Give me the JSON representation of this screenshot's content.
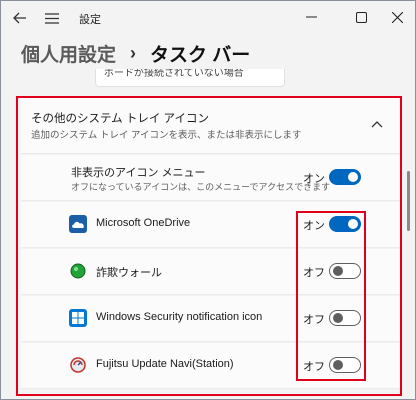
{
  "titlebar": {
    "app_title": "設定",
    "back_icon": "back-arrow-icon",
    "menu_icon": "hamburger-menu-icon"
  },
  "heading": {
    "parent": "個人用設定",
    "separator": "›",
    "current": "タスク バー"
  },
  "partial_dropdown": {
    "text": "ボードが接続されていない場合"
  },
  "section": {
    "title": "その他のシステム トレイ アイコン",
    "description": "追加のシステム トレイ アイコンを表示、または非表示にします",
    "expanded": true
  },
  "hidden_icon_menu": {
    "title": "非表示のアイコン メニュー",
    "subtitle": "オフになっているアイコンは、このメニューでアクセスできます",
    "state": "オン",
    "on": true
  },
  "tray_items": [
    {
      "label": "Microsoft OneDrive",
      "state": "オン",
      "on": true,
      "icon": "onedrive-cloud-icon",
      "icon_color": "#1d5ea8"
    },
    {
      "label": "詐欺ウォール",
      "state": "オフ",
      "on": false,
      "icon": "green-ball-icon",
      "icon_color": "#22a33a"
    },
    {
      "label": "Windows Security notification icon",
      "state": "オフ",
      "on": false,
      "icon": "windows-security-icon",
      "icon_color": "#0078d4"
    },
    {
      "label": "Fujitsu Update Navi(Station)",
      "state": "オフ",
      "on": false,
      "icon": "fujitsu-update-icon",
      "icon_color": "#c0352b"
    }
  ],
  "colors": {
    "accent": "#0067c0",
    "highlight": "#e0001b",
    "background": "#f3f3f3",
    "card": "#fbfbfb"
  }
}
